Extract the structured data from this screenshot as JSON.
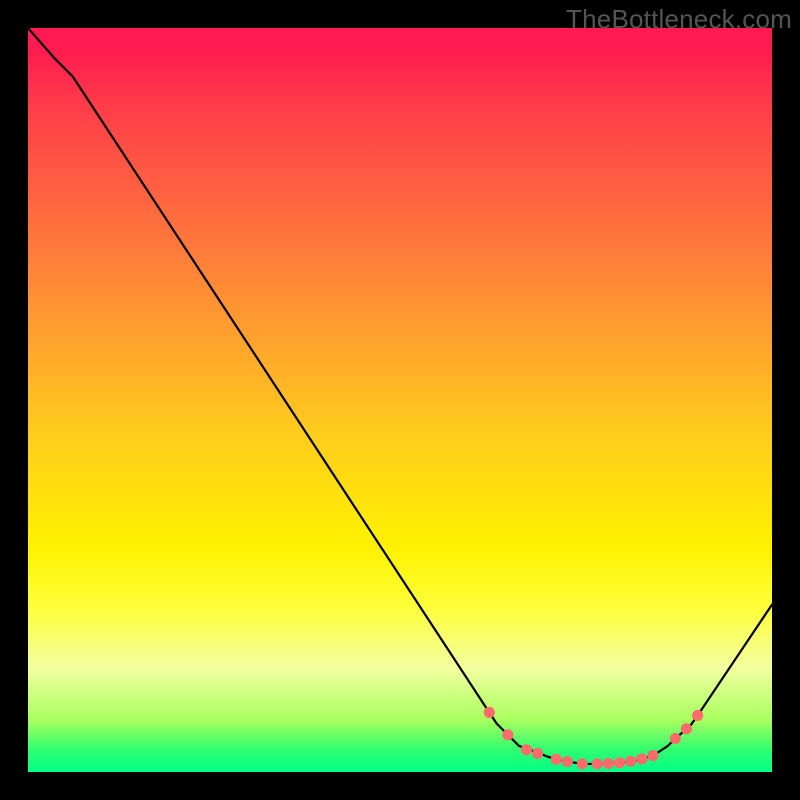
{
  "attribution": "TheBottleneck.com",
  "chart_data": {
    "type": "line",
    "title": "",
    "xlabel": "",
    "ylabel": "",
    "xlim": [
      0,
      100
    ],
    "ylim": [
      0,
      100
    ],
    "series": [
      {
        "name": "curve",
        "x": [
          0,
          3.5,
          6,
          62,
          63,
          66,
          68,
          70,
          72,
          74.5,
          77,
          80,
          82,
          84,
          86,
          87,
          89,
          90,
          100
        ],
        "values": [
          100,
          96,
          93.5,
          8,
          6.5,
          3.5,
          2.8,
          2,
          1.5,
          1.08,
          1.1,
          1.3,
          1.6,
          2.2,
          3.5,
          4.5,
          6.2,
          7.6,
          22.5
        ]
      }
    ],
    "markers": [
      {
        "x": 62.0,
        "y": 8.0
      },
      {
        "x": 64.5,
        "y": 5.0
      },
      {
        "x": 67.0,
        "y": 3.0
      },
      {
        "x": 68.5,
        "y": 2.5
      },
      {
        "x": 71.0,
        "y": 1.7
      },
      {
        "x": 72.5,
        "y": 1.4
      },
      {
        "x": 74.5,
        "y": 1.1
      },
      {
        "x": 76.5,
        "y": 1.1
      },
      {
        "x": 78.0,
        "y": 1.15
      },
      {
        "x": 79.5,
        "y": 1.25
      },
      {
        "x": 81.0,
        "y": 1.45
      },
      {
        "x": 82.5,
        "y": 1.75
      },
      {
        "x": 84.0,
        "y": 2.2
      },
      {
        "x": 87.0,
        "y": 4.5
      },
      {
        "x": 88.5,
        "y": 5.8
      },
      {
        "x": 90.0,
        "y": 7.6
      }
    ],
    "marker_style": {
      "color": "#ff6b6b",
      "radius_pct": 0.75
    },
    "gradient": {
      "orientation": "vertical",
      "stops": [
        {
          "pos": 0.0,
          "color": "#ff1b4f"
        },
        {
          "pos": 0.25,
          "color": "#ff6b3f"
        },
        {
          "pos": 0.55,
          "color": "#ffce1c"
        },
        {
          "pos": 0.78,
          "color": "#fdff3b"
        },
        {
          "pos": 0.93,
          "color": "#a9ff5e"
        },
        {
          "pos": 1.0,
          "color": "#00ff88"
        }
      ]
    }
  }
}
